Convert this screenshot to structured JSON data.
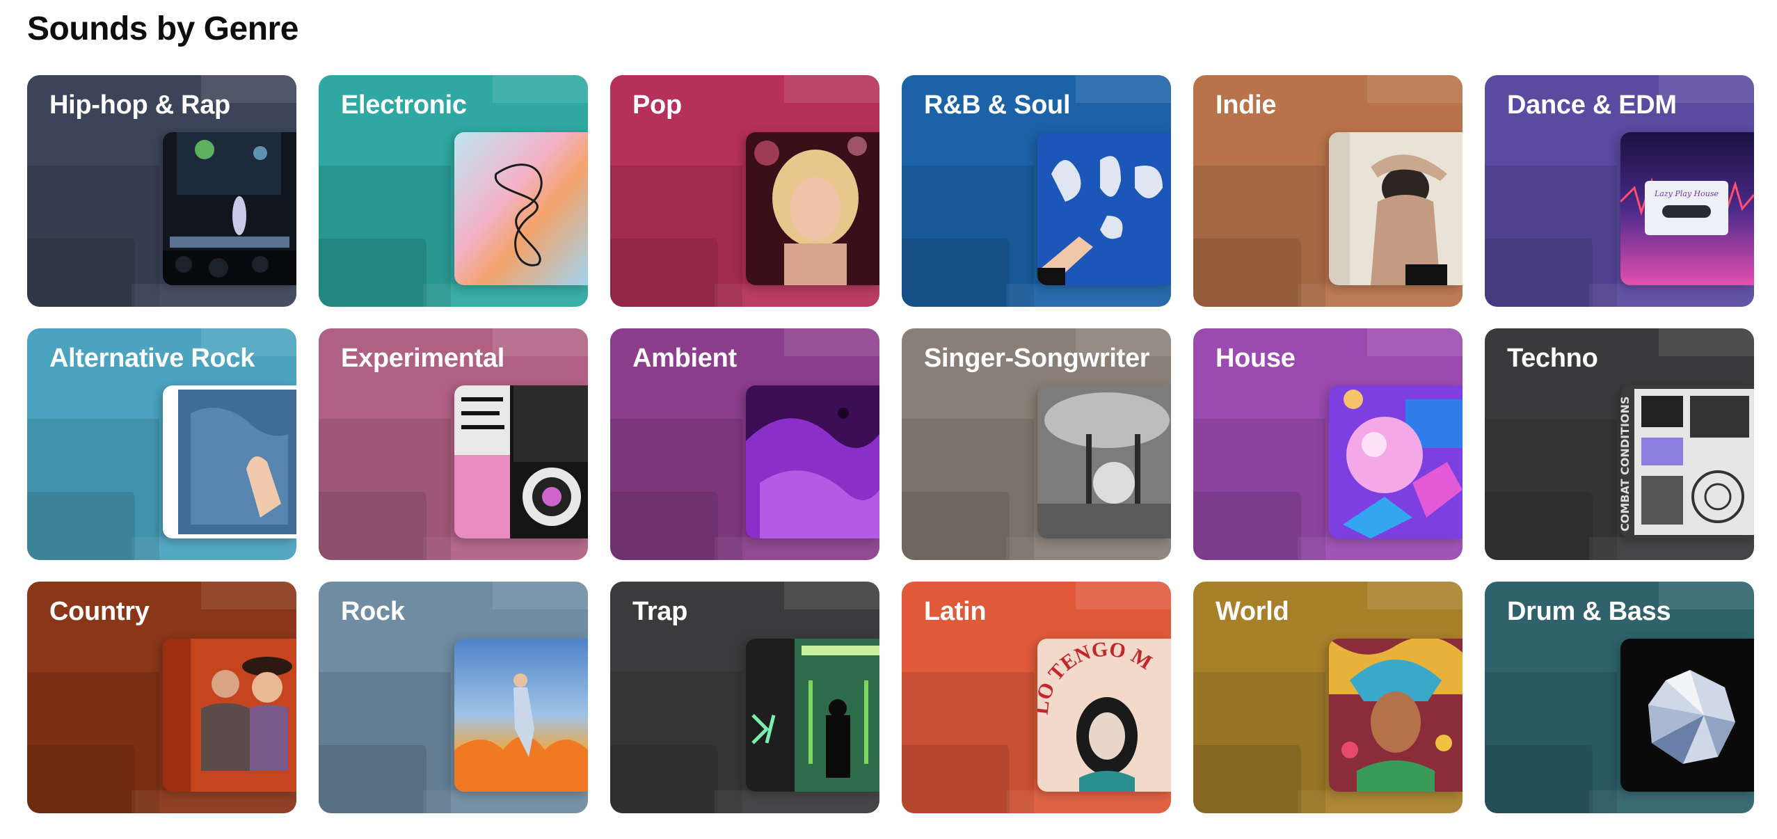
{
  "section": {
    "title": "Sounds by Genre"
  },
  "genres": [
    {
      "label": "Hip-hop & Rap",
      "color": "#3b4459",
      "art": "concert-stage-photo"
    },
    {
      "label": "Electronic",
      "color": "#2ea8a1",
      "art": "iridescent-knot-art"
    },
    {
      "label": "Pop",
      "color": "#b5305a",
      "art": "blonde-singer-portrait"
    },
    {
      "label": "R&B & Soul",
      "color": "#1c62a8",
      "art": "hand-with-chrome-shapes"
    },
    {
      "label": "Indie",
      "color": "#b8734a",
      "art": "woman-back-photo"
    },
    {
      "label": "Dance & EDM",
      "color": "#5a4aa0",
      "art": "cassette-tape-art"
    },
    {
      "label": "Alternative Rock",
      "color": "#4ba3c0",
      "art": "denim-jacket-photo"
    },
    {
      "label": "Experimental",
      "color": "#b06183",
      "art": "collage-poster-art"
    },
    {
      "label": "Ambient",
      "color": "#8b3e8c",
      "art": "purple-fluid-art"
    },
    {
      "label": "Singer-Songwriter",
      "color": "#8a7f76",
      "art": "bw-chair-photo"
    },
    {
      "label": "House",
      "color": "#9b4bb0",
      "art": "3d-sphere-render"
    },
    {
      "label": "Techno",
      "color": "#3a3a3c",
      "art": "combat-conditions-cover"
    },
    {
      "label": "Country",
      "color": "#8a3618",
      "art": "couple-portrait-photo"
    },
    {
      "label": "Rock",
      "color": "#6f8ca3",
      "art": "guitarist-explosion-art"
    },
    {
      "label": "Trap",
      "color": "#3b3b3d",
      "art": "neon-street-cover"
    },
    {
      "label": "Latin",
      "color": "#e05a3a",
      "art": "lo-tengo-cover"
    },
    {
      "label": "World",
      "color": "#a8802a",
      "art": "headdress-portrait-art"
    },
    {
      "label": "Drum & Bass",
      "color": "#2f626b",
      "art": "crystal-orb-art"
    }
  ],
  "cover_text": {
    "latin": "LO TENGO M",
    "techno": "COMBAT CONDITIONS",
    "dance": "Lazy Play House"
  }
}
